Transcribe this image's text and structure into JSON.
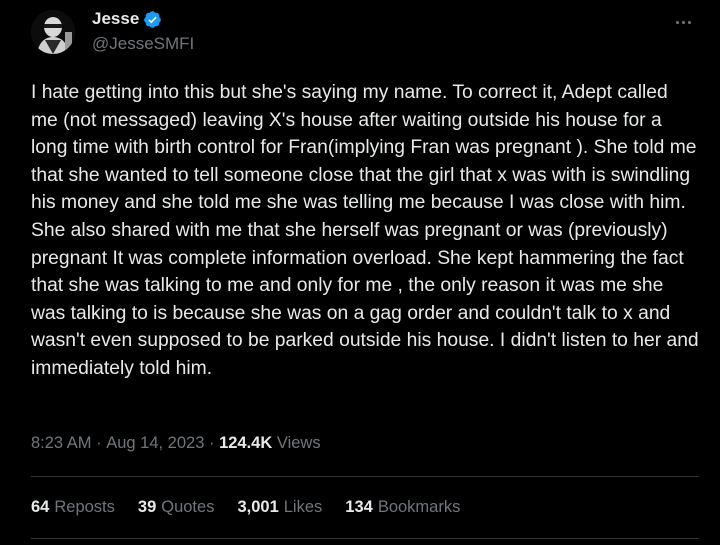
{
  "author": {
    "display_name": "Jesse",
    "handle": "@JesseSMFI",
    "verified": true,
    "verified_color": "#1d9bf0"
  },
  "menu_icon": "more-horizontal-icon",
  "tweet": {
    "text": "I hate getting into this but she's saying my name. To correct it, Adept called me (not messaged) leaving X's house after waiting outside his house for a long time with birth control for Fran(implying Fran was pregnant ). She told me that she wanted to tell someone close that the girl that x was with is swindling his money and she told me she was telling me because I was close with him. She also shared with me that she herself was pregnant or was (previously) pregnant It was complete information overload. She kept hammering the fact that she was talking to me and only for me , the only reason it was me she was talking to is because she was on a gag order and couldn't talk to x and wasn't even supposed to be parked outside his house. I didn't listen to her and immediately told him."
  },
  "meta": {
    "time": "8:23 AM",
    "separator": " · ",
    "date": "Aug 14, 2023",
    "views_count": "124.4K",
    "views_label": "Views"
  },
  "stats": [
    {
      "count": "64",
      "label": "Reposts"
    },
    {
      "count": "39",
      "label": "Quotes"
    },
    {
      "count": "3,001",
      "label": "Likes"
    },
    {
      "count": "134",
      "label": "Bookmarks"
    }
  ],
  "colors": {
    "background": "#000000",
    "text_primary": "#e7e9ea",
    "text_secondary": "#71767b",
    "divider": "#2f3336"
  }
}
